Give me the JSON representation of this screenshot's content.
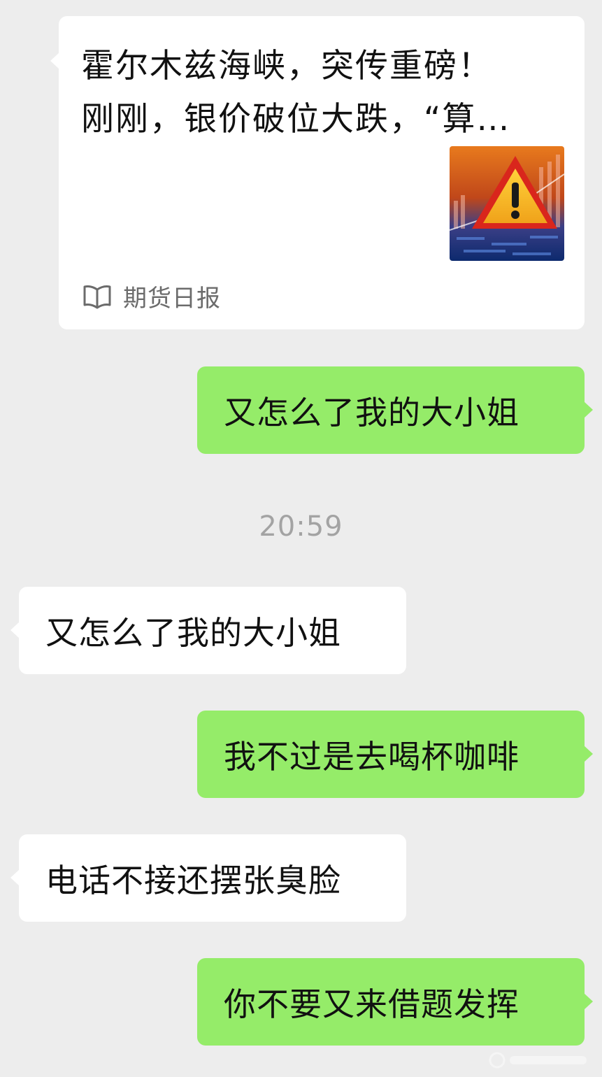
{
  "article_card": {
    "title_line1": "霍尔木兹海峡，突传重磅！",
    "title_line2": "刚刚，银价破位大跌，“算…",
    "source": "期货日报",
    "thumbnail_icon": "warning-triangle-on-stock-chart"
  },
  "messages": [
    {
      "side": "out",
      "text": "又怎么了我的大小姐"
    },
    {
      "side": "in",
      "text": "又怎么了我的大小姐"
    },
    {
      "side": "out",
      "text": "我不过是去喝杯咖啡"
    },
    {
      "side": "in",
      "text": "电话不接还摆张臭脸"
    },
    {
      "side": "out",
      "text": "你不要又来借题发挥"
    }
  ],
  "timestamp": "20:59",
  "colors": {
    "background": "#ededed",
    "incoming_bubble": "#ffffff",
    "outgoing_bubble": "#95ec69",
    "timestamp": "#a3a3a3",
    "source_text": "#6b6b6b"
  }
}
